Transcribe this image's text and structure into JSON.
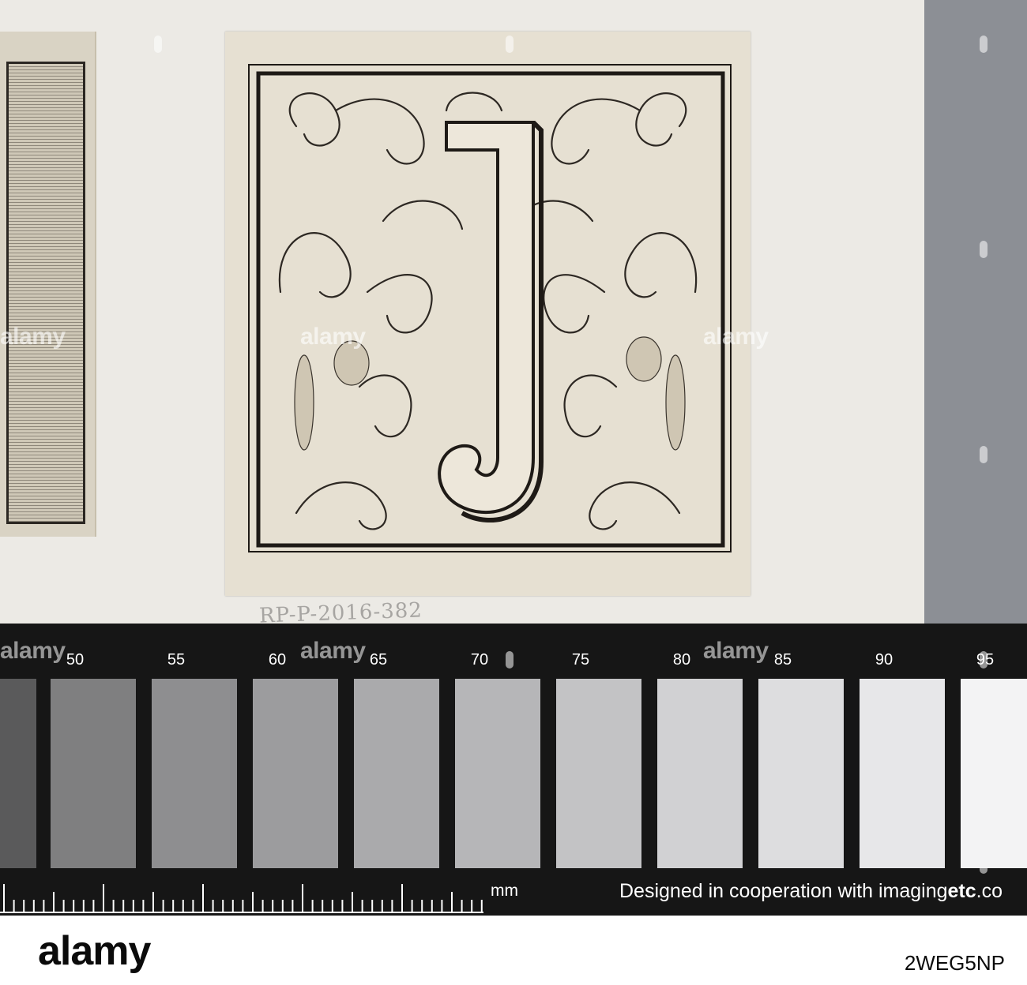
{
  "watermark": {
    "text": "alamy"
  },
  "inventory_note": "RP-P-2016-382",
  "scale_card": {
    "ticks": [
      "50",
      "55",
      "60",
      "65",
      "70",
      "75",
      "80",
      "85",
      "90",
      "95"
    ],
    "unit": "mm",
    "credit_prefix": "Designed in cooperation with imaging",
    "credit_brand": "etc",
    "credit_suffix": ".co",
    "patch_colors": [
      "#5a5a5b",
      "#7f7f80",
      "#8e8e90",
      "#9c9c9e",
      "#aaaaac",
      "#b6b6b8",
      "#c3c3c5",
      "#d1d1d3",
      "#dddddf",
      "#e7e7e9",
      "#f3f3f4"
    ]
  },
  "footer": {
    "logo": "alamy",
    "image_id": "2WEG5NP"
  },
  "print": {
    "letter": "J"
  }
}
